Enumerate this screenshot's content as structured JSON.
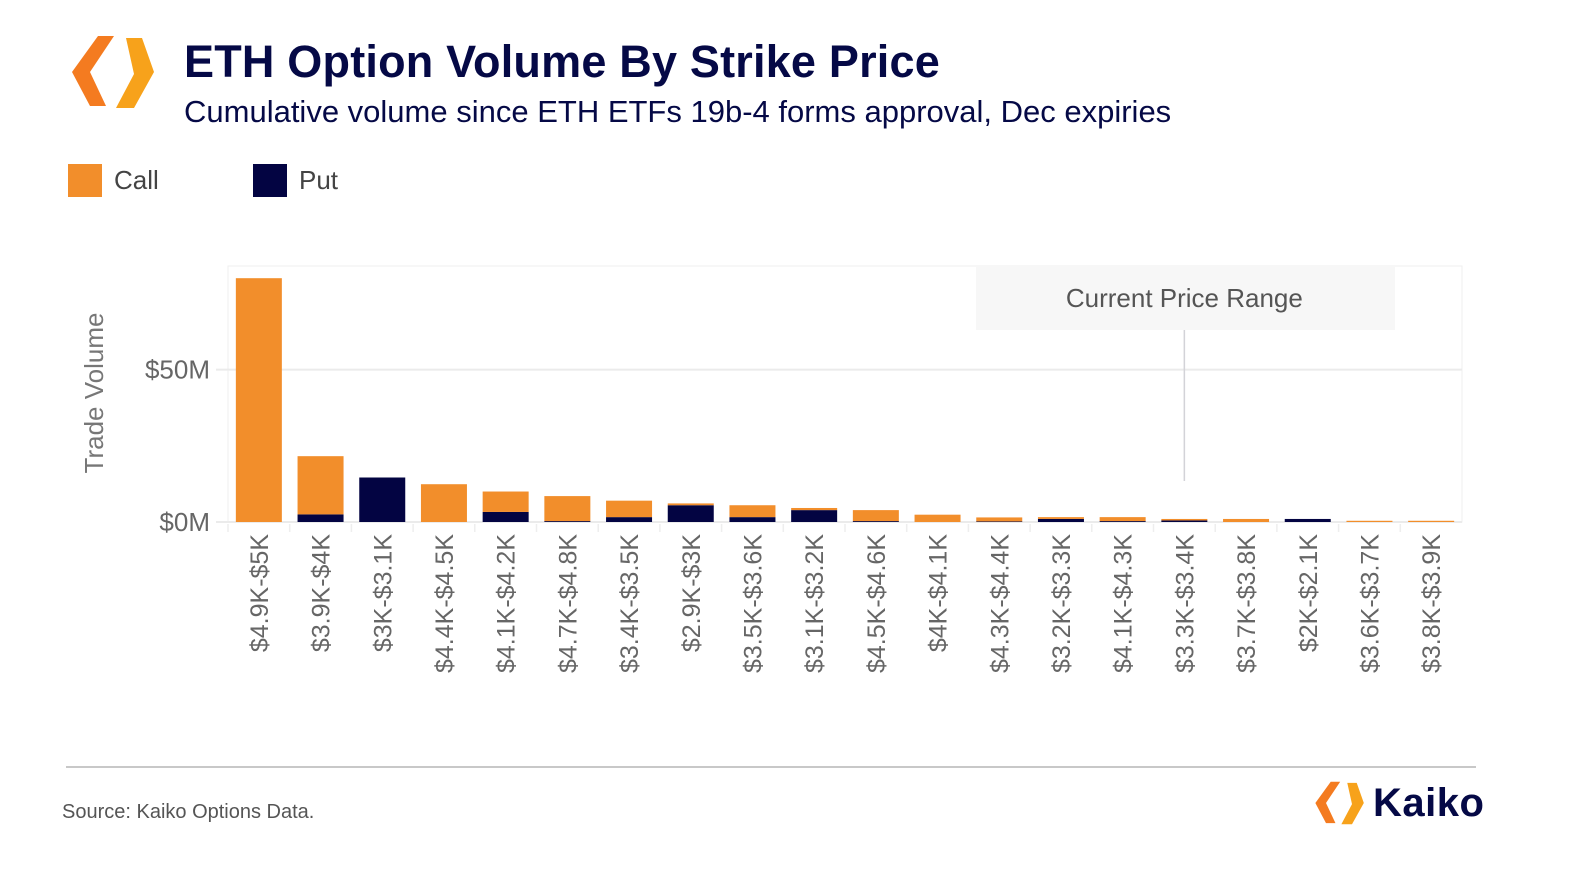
{
  "header": {
    "title": "ETH Option Volume By Strike Price",
    "subtitle": "Cumulative volume since ETH ETFs 19b-4 forms approval, Dec expiries",
    "logo_icon": "kaiko-hexagon-logo-icon"
  },
  "footer": {
    "source": "Source: Kaiko Options Data.",
    "brand_name": "Kaiko"
  },
  "colors": {
    "call": "#F28E2B",
    "put": "#030442",
    "title": "#050946",
    "annotation_bg": "#F7F7F7",
    "gridline": "#EBEBEB",
    "logo_orange": "#F7A21B",
    "logo_dark_orange": "#F47B20"
  },
  "chart_data": {
    "type": "bar",
    "stacked": true,
    "title": "ETH Option Volume By Strike Price",
    "subtitle": "Cumulative volume since ETH ETFs 19b-4 forms approval, Dec expiries",
    "xlabel": "",
    "ylabel": "Trade Volume",
    "ylim": [
      0,
      84
    ],
    "y_units": "$M",
    "yticks": [
      0,
      50
    ],
    "ytick_labels": [
      "$0M",
      "$50M"
    ],
    "grid": true,
    "legend": {
      "placement": "top-left",
      "entries": [
        {
          "name": "Call",
          "color": "#F28E2B"
        },
        {
          "name": "Put",
          "color": "#030442"
        }
      ]
    },
    "categories": [
      "$4.9K-$5K",
      "$3.9K-$4K",
      "$3K-$3.1K",
      "$4.4K-$4.5K",
      "$4.1K-$4.2K",
      "$4.7K-$4.8K",
      "$3.4K-$3.5K",
      "$2.9K-$3K",
      "$3.5K-$3.6K",
      "$3.1K-$3.2K",
      "$4.5K-$4.6K",
      "$4K-$4.1K",
      "$4.3K-$4.4K",
      "$3.2K-$3.3K",
      "$4.1K-$4.3K",
      "$3.3K-$3.4K",
      "$3.7K-$3.8K",
      "$2K-$2.1K",
      "$3.6K-$3.7K",
      "$3.8K-$3.9K"
    ],
    "series": [
      {
        "name": "Put",
        "color": "#030442",
        "values": [
          0,
          2.5,
          14.6,
          0,
          3.3,
          0.3,
          1.6,
          5.5,
          1.6,
          3.9,
          0.3,
          0,
          0.2,
          1.0,
          0.3,
          0.5,
          0,
          1.0,
          0,
          0
        ]
      },
      {
        "name": "Call",
        "color": "#F28E2B",
        "values": [
          80.0,
          19.1,
          0,
          12.4,
          6.7,
          8.2,
          5.4,
          0.6,
          3.9,
          0.7,
          3.6,
          2.4,
          1.3,
          0.6,
          1.3,
          0.5,
          1.0,
          0,
          0.4,
          0.4
        ]
      }
    ],
    "annotations": [
      {
        "text": "Current Price Range",
        "target_category": "$3.3K-$3.4K"
      }
    ]
  }
}
